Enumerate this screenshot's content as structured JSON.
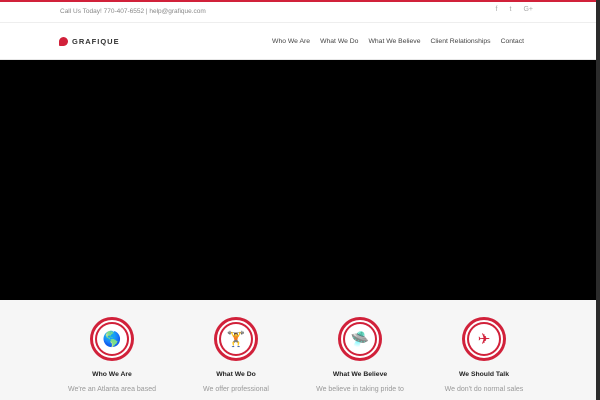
{
  "topbar": {
    "contact": "Call Us Today! 770-407-6552 | help@grafique.com",
    "social": [
      "f",
      "t",
      "G+"
    ]
  },
  "header": {
    "logo": "GRAFIQUE",
    "nav": [
      "Who We Are",
      "What We Do",
      "What We Believe",
      "Client Relationships",
      "Contact"
    ]
  },
  "features": [
    {
      "icon": "globe-icon",
      "glyph": "🌎",
      "title": "Who We Are",
      "text": "We're an Atlanta area based"
    },
    {
      "icon": "dumbbell-icon",
      "glyph": "🏋",
      "title": "What We Do",
      "text": "We offer professional"
    },
    {
      "icon": "ufo-icon",
      "glyph": "🛸",
      "title": "What We Believe",
      "text": "We believe in taking pride to"
    },
    {
      "icon": "paper-plane-icon",
      "glyph": "✈",
      "title": "We Should Talk",
      "text": "We don't do normal sales"
    }
  ],
  "colors": {
    "accent": "#d1213a"
  }
}
